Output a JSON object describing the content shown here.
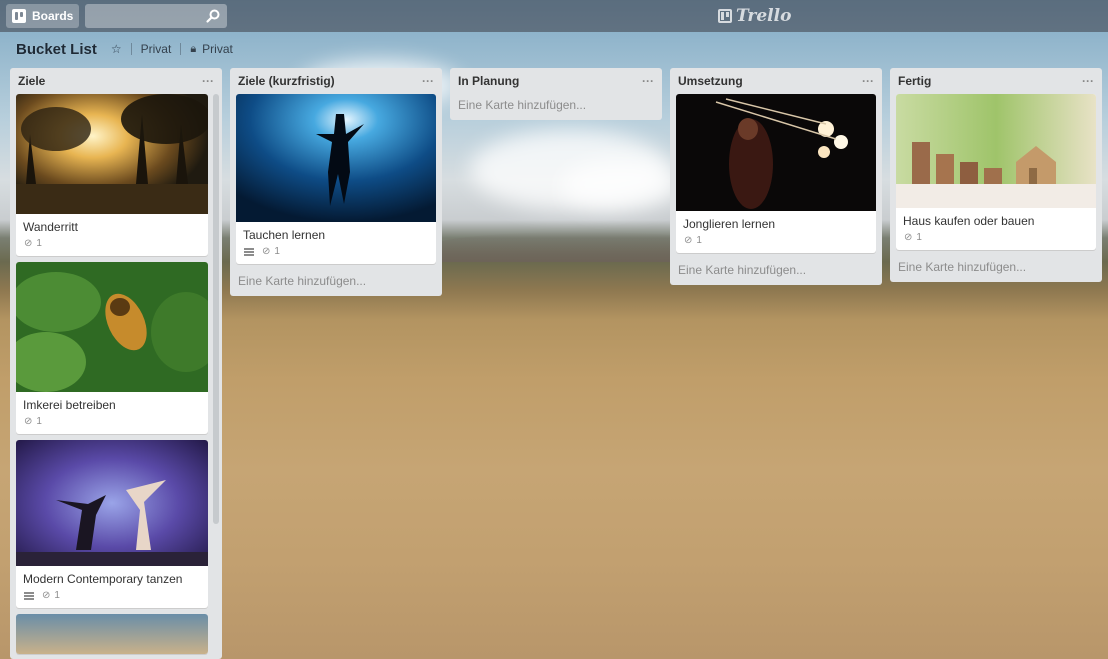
{
  "header": {
    "boards_label": "Boards",
    "search_placeholder": "",
    "logo_text": "Trello"
  },
  "board": {
    "title": "Bucket List",
    "visibility_1": "Privat",
    "visibility_2": "Privat"
  },
  "lists": [
    {
      "title": "Ziele",
      "cards": [
        {
          "title": "Wanderritt",
          "attachments": "1"
        },
        {
          "title": "Imkerei betreiben",
          "attachments": "1"
        },
        {
          "title": "Modern Contemporary tanzen",
          "attachments": "1"
        }
      ]
    },
    {
      "title": "Ziele (kurzfristig)",
      "cards": [
        {
          "title": "Tauchen lernen",
          "attachments": "1"
        }
      ],
      "add_card": "Eine Karte hinzufügen..."
    },
    {
      "title": "In Planung",
      "add_card": "Eine Karte hinzufügen..."
    },
    {
      "title": "Umsetzung",
      "cards": [
        {
          "title": "Jonglieren lernen",
          "attachments": "1"
        }
      ],
      "add_card": "Eine Karte hinzufügen..."
    },
    {
      "title": "Fertig",
      "cards": [
        {
          "title": "Haus kaufen oder bauen",
          "attachments": "1"
        }
      ],
      "add_card": "Eine Karte hinzufügen..."
    }
  ],
  "list_menu_glyph": "···"
}
